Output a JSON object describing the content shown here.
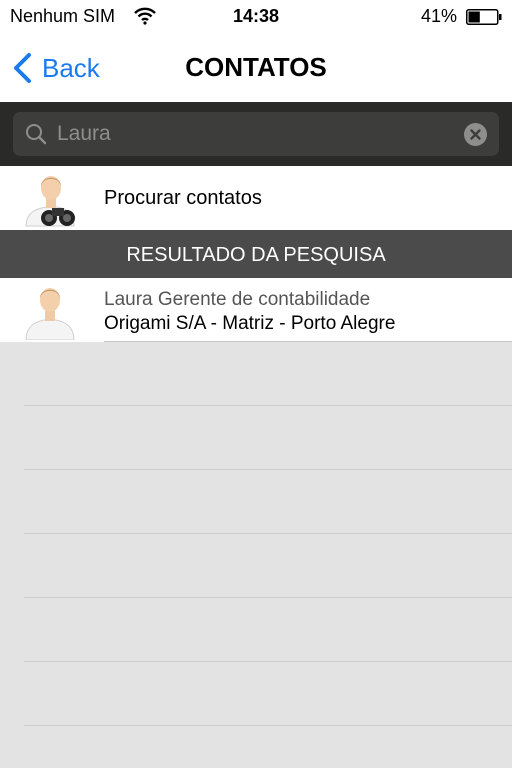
{
  "status_bar": {
    "carrier": "Nenhum SIM",
    "wifi_icon": "wifi-icon",
    "time": "14:38",
    "battery_percent": "41%",
    "battery_level": 0.41
  },
  "nav": {
    "back_label": "Back",
    "title": "CONTATOS"
  },
  "search": {
    "value": "Laura",
    "search_icon": "search-icon",
    "clear_icon": "clear-icon"
  },
  "find_contacts": {
    "label": "Procurar contatos",
    "icon": "contact-binoculars-icon"
  },
  "results_header": "RESULTADO DA PESQUISA",
  "results": [
    {
      "name_role": "Laura Gerente de contabilidade",
      "company": "Origami S/A - Matriz - Porto Alegre",
      "icon": "person-avatar-icon"
    }
  ],
  "colors": {
    "accent": "#1a7bf0",
    "search_bar_bg": "#2a2a28",
    "section_header_bg": "#4b4b4b",
    "list_bg": "#e3e3e3"
  }
}
